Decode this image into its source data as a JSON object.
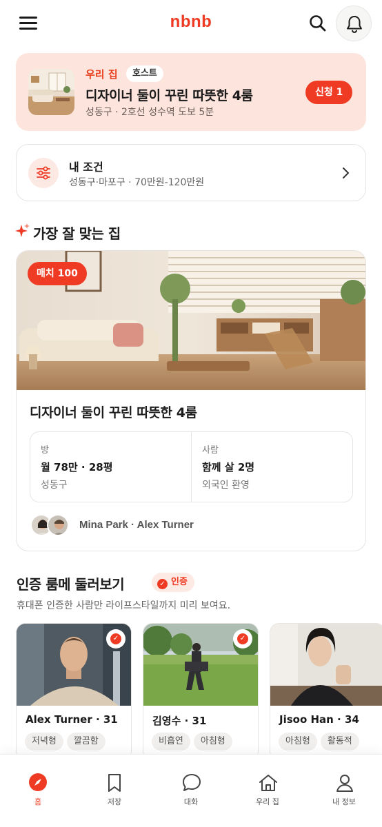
{
  "header": {
    "brand": "nbnb"
  },
  "host_card": {
    "tag": "우리 집",
    "role_badge": "호스트",
    "title": "디자이너 둘이 꾸린 따뜻한 4룸",
    "subtitle": "성동구 · 2호선 성수역 도보 5분",
    "apply_badge": "신청 1"
  },
  "conditions": {
    "title": "내 조건",
    "summary": "성동구·마포구 · 70만원-120만원"
  },
  "best_match": {
    "section_title": "가장 잘 맞는 집",
    "match_badge": "매치 100",
    "title": "디자이너 둘이 꾸린 따뜻한 4룸",
    "room": {
      "label": "방",
      "main": "월 78만 · 28평",
      "sub": "성동구"
    },
    "people": {
      "label": "사람",
      "main": "함께 살 2명",
      "sub": "외국인 환영"
    },
    "residents": "Mina Park · Alex Turner"
  },
  "verified": {
    "section_title": "인증 룸메 둘러보기",
    "badge": "인증",
    "subtitle": "휴대폰 인증한 사람만 라이프스타일까지 미리 보여요.",
    "mates": [
      {
        "name": "Alex Turner · 31",
        "tags": [
          "저녁형",
          "깔끔함"
        ]
      },
      {
        "name": "김영수 · 31",
        "tags": [
          "비흡연",
          "아침형"
        ]
      },
      {
        "name": "Jisoo Han · 34",
        "tags": [
          "아침형",
          "활동적"
        ]
      }
    ]
  },
  "bottom_nav": {
    "items": [
      {
        "label": "홈",
        "icon": "compass-icon",
        "active": true
      },
      {
        "label": "저장",
        "icon": "bookmark-icon",
        "active": false
      },
      {
        "label": "대화",
        "icon": "chat-icon",
        "active": false
      },
      {
        "label": "우리 집",
        "icon": "home-icon",
        "active": false
      },
      {
        "label": "내 정보",
        "icon": "profile-icon",
        "active": false
      }
    ]
  },
  "colors": {
    "accent": "#ef3b24",
    "host_card_bg": "#fde4dc",
    "border": "#e7e4e2"
  }
}
